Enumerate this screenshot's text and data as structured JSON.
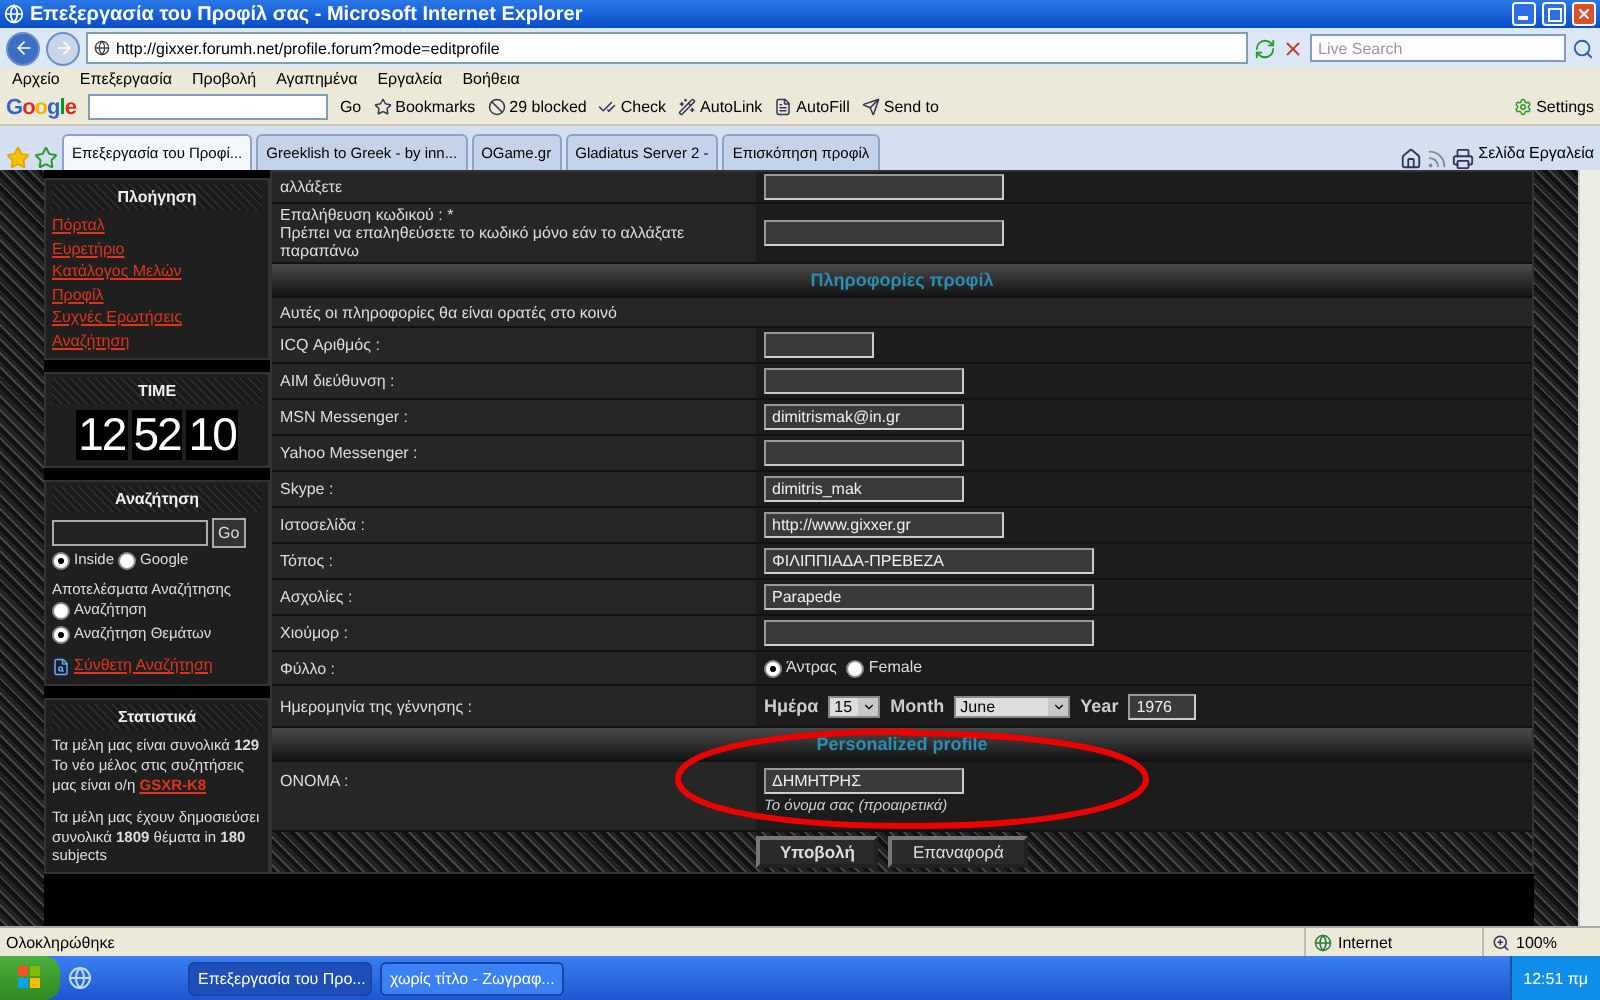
{
  "window": {
    "title": "Επεξεργασία του Προφίλ σας - Microsoft Internet Explorer"
  },
  "address_bar": {
    "url": "http://gixxer.forumh.net/profile.forum?mode=editprofile",
    "search_placeholder": "Live Search"
  },
  "menu": [
    "Αρχείο",
    "Επεξεργασία",
    "Προβολή",
    "Αγαπημένα",
    "Εργαλεία",
    "Βοήθεια"
  ],
  "google_toolbar": {
    "logo": "Google",
    "go": "Go",
    "items": [
      "Bookmarks",
      "29 blocked",
      "Check",
      "AutoLink",
      "AutoFill",
      "Send to"
    ],
    "settings": "Settings"
  },
  "tabs": [
    {
      "label": "Επεξεργασία του Προφί...",
      "selected": true
    },
    {
      "label": "Greeklish to Greek - by inn...",
      "selected": false
    },
    {
      "label": "OGame.gr",
      "selected": false
    },
    {
      "label": "Gladiatus Server 2 -",
      "selected": false
    },
    {
      "label": "Επισκόπηση προφίλ",
      "selected": false
    }
  ],
  "command_bar": [
    "Σελίδα",
    "Εργαλεία"
  ],
  "sidebar": {
    "navigation": {
      "title": "Πλοήγηση",
      "links": [
        "Πόρταλ",
        "Ευρετήριο",
        "Κατάλογος Μελών",
        "Προφίλ",
        "Συχνές Ερωτήσεις",
        "Αναζήτηση"
      ]
    },
    "time": {
      "title": "TIME",
      "digits": [
        "12",
        "52",
        "10"
      ]
    },
    "search": {
      "title": "Αναζήτηση",
      "go": "Go",
      "scopes": [
        {
          "label": "Inside",
          "selected": true
        },
        {
          "label": "Google",
          "selected": false
        }
      ],
      "results_label": "Αποτελέσματα Αναζήτησης",
      "result_types": [
        {
          "label": "Αναζήτηση",
          "selected": false
        },
        {
          "label": "Αναζήτηση Θεμάτων",
          "selected": true
        }
      ],
      "advanced_link": "Σύνθετη Αναζήτηση"
    },
    "stats": {
      "title": "Στατιστικά",
      "members": "Τα μέλη μας είναι συνολικά **129**",
      "newest": "Το νέο μέλος στις συζητήσεις μας είναι ο/η",
      "newest_link": "GSXR-K8",
      "posts": "Τα μέλη μας έχουν δημοσιεύσει συνολικά **1809** θέματα in **180** subjects"
    }
  },
  "form": {
    "rows": [
      {
        "kind": "text",
        "label": "αλλάξετε",
        "value": ""
      },
      {
        "kind": "text",
        "label": "Επαλήθευση κωδικού : *",
        "note": "Πρέπει να επαληθεύσετε το κωδικό μόνο εάν το αλλάξατε παραπάνω",
        "value": ""
      },
      {
        "kind": "section",
        "label": "Πληροφορίες προφίλ"
      },
      {
        "kind": "intro",
        "label": "Αυτές οι πληροφορίες θα είναι ορατές στο κοινό"
      },
      {
        "kind": "text",
        "label": "ICQ Αριθμός :",
        "value": ""
      },
      {
        "kind": "text",
        "label": "AIM διεύθυνση :",
        "value": ""
      },
      {
        "kind": "text",
        "label": "MSN Messenger :",
        "value": "dimitrismak@in.gr"
      },
      {
        "kind": "text",
        "label": "Yahoo Messenger :",
        "value": ""
      },
      {
        "kind": "text",
        "label": "Skype :",
        "value": "dimitris_mak"
      },
      {
        "kind": "text",
        "label": "Ιστοσελίδα :",
        "value": "http://www.gixxer.gr"
      },
      {
        "kind": "text",
        "label": "Τόπος :",
        "value": "ΦΙΛΙΠΠΙΑΔΑ-ΠΡΕΒΕΖΑ"
      },
      {
        "kind": "text",
        "label": "Ασχολίες :",
        "value": "Parapede"
      },
      {
        "kind": "text",
        "label": "Χιούμορ :",
        "value": ""
      },
      {
        "kind": "radio",
        "label": "Φύλλο :",
        "options": [
          {
            "label": "Άντρας",
            "selected": true
          },
          {
            "label": "Female",
            "selected": false
          }
        ]
      },
      {
        "kind": "date",
        "label": "Ημερομηνία της γέννησης :",
        "day_label": "Ημέρα",
        "day": "15",
        "month_label": "Month",
        "month": "June",
        "year_label": "Year",
        "year": "1976"
      },
      {
        "kind": "section",
        "label": "Personalized profile"
      },
      {
        "kind": "text",
        "label": "ΟΝΟΜΑ :",
        "value": "ΔΗΜΗΤΡΗΣ",
        "hint": "Το όνομα σας (προαιρετικά)"
      },
      {
        "kind": "buttons",
        "buttons": [
          "Υποβολή",
          "Επαναφορά"
        ]
      }
    ]
  },
  "status_bar": {
    "text": "Ολοκληρώθηκε",
    "zone": "Internet",
    "zoom": "100%"
  },
  "taskbar": {
    "tasks": [
      {
        "label": "Επεξεργασία του Προ...",
        "selected": true
      },
      {
        "label": "χωρίς τίτλο - Ζωγραφ...",
        "selected": false
      }
    ],
    "clock": "12:51 πμ"
  }
}
